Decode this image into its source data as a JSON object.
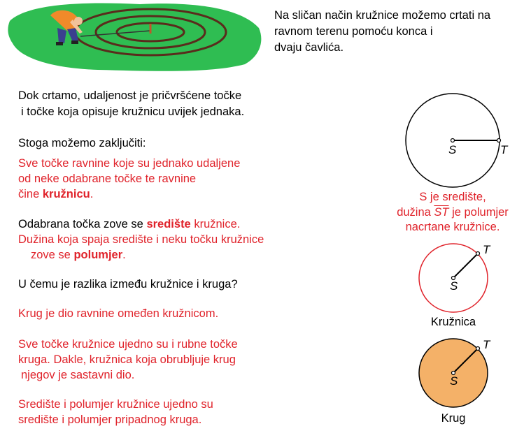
{
  "intro": {
    "lines": [
      "Na sličan način kružnice možemo crtati na",
      "ravnom terenu pomoću konca i",
      "dvaju čavlića."
    ]
  },
  "p1": {
    "lines": [
      "Dok crtamo, udaljenost je pričvršćene točke",
      "i točke koja opisuje kružnicu uvijek jednaka."
    ]
  },
  "p2": {
    "text": "Stoga možemo zaključiti:"
  },
  "p3": {
    "line1": "Sve točke ravnine koje su jednako udaljene",
    "line2": "od neke odabrane točke te ravnine",
    "line3_pre": "čine ",
    "line3_bold": "kružnicu",
    "line3_post": "."
  },
  "p4": {
    "pre": "Odabrana točka zove se ",
    "bold": "središte",
    "post": " kružnice.",
    "line2": "Dužina koja spaja središte i neku točku kružnice",
    "line3_pre": "zove se ",
    "line3_bold": "polumjer",
    "line3_post": "."
  },
  "question": {
    "text": "U čemu je razlika između kružnice i kruga?"
  },
  "answer1": {
    "text": "Krug je dio ravnine omeđen kružnicom."
  },
  "answer2": {
    "lines": [
      "Sve točke kružnice ujedno su i rubne točke",
      "kruga. Dakle, kružnica koja obrubljuje krug",
      "njegov je sastavni dio."
    ]
  },
  "answer3": {
    "lines": [
      "Središte i polumjer kružnice ujedno su",
      "središte i polumjer pripadnog kruga."
    ]
  },
  "fig1": {
    "center_label": "S",
    "point_label": "T",
    "caption": {
      "line1": "S je središte,",
      "line2_pre": "dužina ",
      "line2_segment": "ST",
      "line2_post": " je polumjer",
      "line3": "nacrtane kružnice."
    }
  },
  "fig2": {
    "center_label": "S",
    "point_label": "T",
    "caption": "Kružnica"
  },
  "fig3": {
    "center_label": "S",
    "point_label": "T",
    "caption": "Krug"
  },
  "colors": {
    "red_text": "#e0232b",
    "grass": "#2fbd52",
    "circle_red": "#e0232b",
    "disk_fill": "#f4b168"
  }
}
